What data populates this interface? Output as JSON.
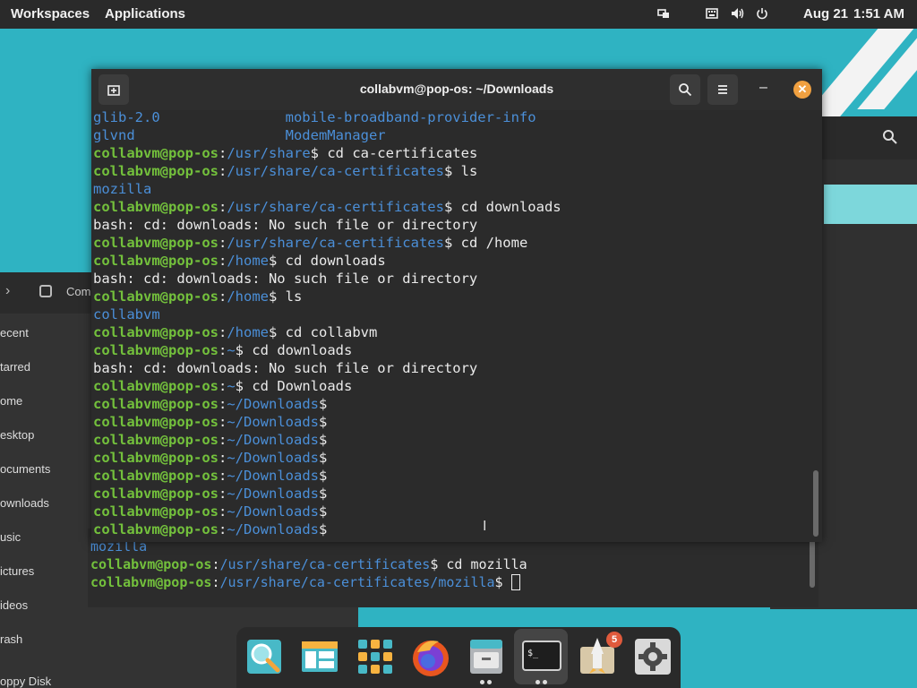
{
  "topbar": {
    "workspaces": "Workspaces",
    "applications": "Applications",
    "date": "Aug 21",
    "time": "1:51 AM",
    "tray_icons": [
      "screen-icon",
      "keyboard-icon",
      "volume-icon",
      "power-icon"
    ]
  },
  "files_window": {
    "location_label": "Com",
    "sidebar": [
      "ecent",
      "tarred",
      "ome",
      "esktop",
      "ocuments",
      "ownloads",
      "usic",
      "ictures",
      "ideos",
      "rash",
      "oppy Disk"
    ]
  },
  "terminal": {
    "title": "collabvm@pop-os: ~/Downloads",
    "lines": [
      [
        [
          "b",
          "glib-2.0               "
        ],
        [
          "b",
          "mobile-broadband-provider-info"
        ]
      ],
      [
        [
          "b",
          "glvnd                  "
        ],
        [
          "b",
          "ModemManager"
        ]
      ],
      [
        [
          "g",
          "collabvm@pop-os"
        ],
        [
          "w",
          ":"
        ],
        [
          "b",
          "/usr/share"
        ],
        [
          "w",
          "$ cd ca-certificates"
        ]
      ],
      [
        [
          "g",
          "collabvm@pop-os"
        ],
        [
          "w",
          ":"
        ],
        [
          "b",
          "/usr/share/ca-certificates"
        ],
        [
          "w",
          "$ ls"
        ]
      ],
      [
        [
          "b",
          "mozilla"
        ]
      ],
      [
        [
          "g",
          "collabvm@pop-os"
        ],
        [
          "w",
          ":"
        ],
        [
          "b",
          "/usr/share/ca-certificates"
        ],
        [
          "w",
          "$ cd downloads"
        ]
      ],
      [
        [
          "w",
          "bash: cd: downloads: No such file or directory"
        ]
      ],
      [
        [
          "g",
          "collabvm@pop-os"
        ],
        [
          "w",
          ":"
        ],
        [
          "b",
          "/usr/share/ca-certificates"
        ],
        [
          "w",
          "$ cd /home"
        ]
      ],
      [
        [
          "g",
          "collabvm@pop-os"
        ],
        [
          "w",
          ":"
        ],
        [
          "b",
          "/home"
        ],
        [
          "w",
          "$ cd downloads"
        ]
      ],
      [
        [
          "w",
          "bash: cd: downloads: No such file or directory"
        ]
      ],
      [
        [
          "g",
          "collabvm@pop-os"
        ],
        [
          "w",
          ":"
        ],
        [
          "b",
          "/home"
        ],
        [
          "w",
          "$ ls"
        ]
      ],
      [
        [
          "b",
          "collabvm"
        ]
      ],
      [
        [
          "g",
          "collabvm@pop-os"
        ],
        [
          "w",
          ":"
        ],
        [
          "b",
          "/home"
        ],
        [
          "w",
          "$ cd collabvm"
        ]
      ],
      [
        [
          "g",
          "collabvm@pop-os"
        ],
        [
          "w",
          ":"
        ],
        [
          "b",
          "~"
        ],
        [
          "w",
          "$ cd downloads"
        ]
      ],
      [
        [
          "w",
          "bash: cd: downloads: No such file or directory"
        ]
      ],
      [
        [
          "g",
          "collabvm@pop-os"
        ],
        [
          "w",
          ":"
        ],
        [
          "b",
          "~"
        ],
        [
          "w",
          "$ cd Downloads"
        ]
      ],
      [
        [
          "g",
          "collabvm@pop-os"
        ],
        [
          "w",
          ":"
        ],
        [
          "b",
          "~/Downloads"
        ],
        [
          "w",
          "$"
        ]
      ],
      [
        [
          "g",
          "collabvm@pop-os"
        ],
        [
          "w",
          ":"
        ],
        [
          "b",
          "~/Downloads"
        ],
        [
          "w",
          "$"
        ]
      ],
      [
        [
          "g",
          "collabvm@pop-os"
        ],
        [
          "w",
          ":"
        ],
        [
          "b",
          "~/Downloads"
        ],
        [
          "w",
          "$"
        ]
      ],
      [
        [
          "g",
          "collabvm@pop-os"
        ],
        [
          "w",
          ":"
        ],
        [
          "b",
          "~/Downloads"
        ],
        [
          "w",
          "$"
        ]
      ],
      [
        [
          "g",
          "collabvm@pop-os"
        ],
        [
          "w",
          ":"
        ],
        [
          "b",
          "~/Downloads"
        ],
        [
          "w",
          "$"
        ]
      ],
      [
        [
          "g",
          "collabvm@pop-os"
        ],
        [
          "w",
          ":"
        ],
        [
          "b",
          "~/Downloads"
        ],
        [
          "w",
          "$"
        ]
      ],
      [
        [
          "g",
          "collabvm@pop-os"
        ],
        [
          "w",
          ":"
        ],
        [
          "b",
          "~/Downloads"
        ],
        [
          "w",
          "$"
        ]
      ],
      [
        [
          "g",
          "collabvm@pop-os"
        ],
        [
          "w",
          ":"
        ],
        [
          "b",
          "~/Downloads"
        ],
        [
          "w",
          "$"
        ]
      ]
    ]
  },
  "terminal2": {
    "lines": [
      [
        [
          "b",
          "mozilla"
        ]
      ],
      [
        [
          "g",
          "collabvm@pop-os"
        ],
        [
          "w",
          ":"
        ],
        [
          "b",
          "/usr/share/ca-certificates"
        ],
        [
          "w",
          "$ cd mozilla"
        ]
      ],
      [
        [
          "g",
          "collabvm@pop-os"
        ],
        [
          "w",
          ":"
        ],
        [
          "b",
          "/usr/share/ca-certificates/mozilla"
        ],
        [
          "w",
          "$ "
        ]
      ]
    ]
  },
  "dock": {
    "items": [
      "search-app-icon",
      "files-manager-icon",
      "app-grid-icon",
      "firefox-icon",
      "file-cabinet-icon",
      "terminal-icon",
      "pop-shop-icon",
      "settings-icon"
    ],
    "shop_badge": "5",
    "terminal_glyph": "$_"
  }
}
